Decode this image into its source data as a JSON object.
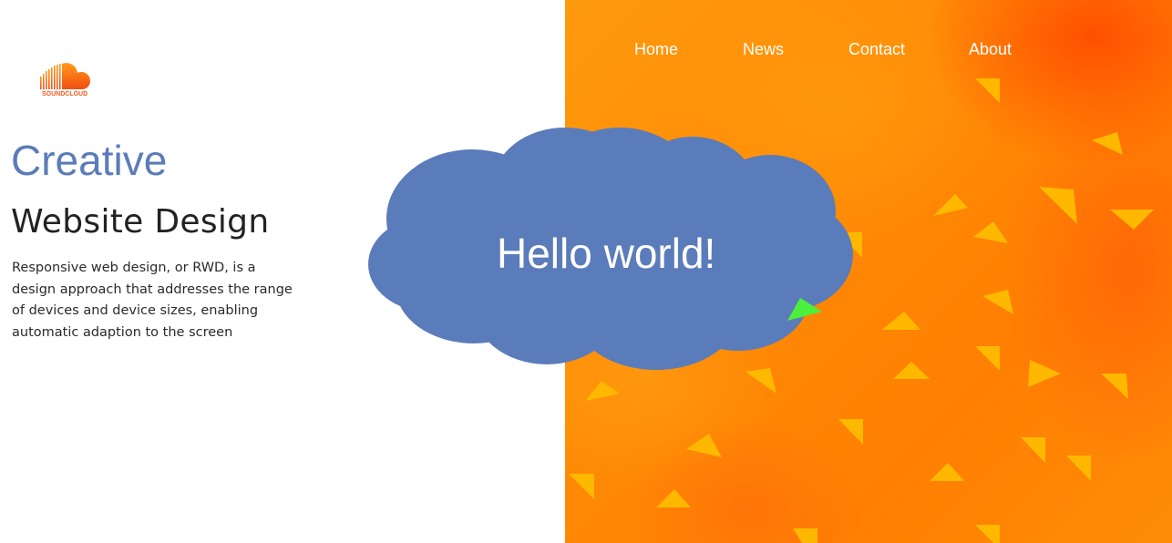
{
  "nav": {
    "items": [
      {
        "label": "Home"
      },
      {
        "label": "News"
      },
      {
        "label": "Contact"
      },
      {
        "label": "About"
      }
    ]
  },
  "logo": {
    "text": "SOUNDCLOUD",
    "color": "#f25a1d"
  },
  "hero": {
    "title_line1": "Creative",
    "title_line2": "Website Design",
    "description": "Responsive web design, or RWD, is a design approach that addresses the range of devices and device sizes, enabling automatic adaption to the screen"
  },
  "cloud": {
    "text": "Hello world!",
    "color": "#5b7cba"
  },
  "colors": {
    "accent_blue": "#5b7cba",
    "orange": "#ff8a06",
    "triangle_yellow": "#ffb800",
    "pointer_green": "#4cf03c"
  }
}
